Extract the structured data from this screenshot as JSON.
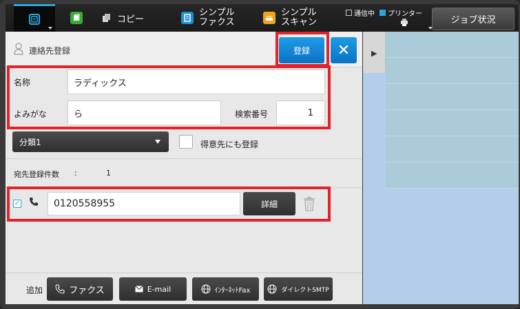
{
  "topbar": {
    "copy_label": "コピー",
    "simple_fax_label_1": "シンプル",
    "simple_fax_label_2": "ファクス",
    "simple_scan_label_1": "シンプル",
    "simple_scan_label_2": "スキャン",
    "status_sending": "通信中",
    "status_printer": "プリンター",
    "job_status_button": "ジョブ状況",
    "accent_color": "#2aa6e0"
  },
  "header": {
    "title": "連絡先登録",
    "register_button": "登録",
    "close_button": "✕"
  },
  "form": {
    "name_label": "名称",
    "name_value": "ラディックス",
    "reading_label": "よみがな",
    "reading_value": "ら",
    "search_number_label": "検索番号",
    "search_number_value": "1",
    "category_value": "分類1",
    "favorite_label": "得意先にも登録"
  },
  "destinations": {
    "count_label": "宛先登録件数",
    "count_separator": ":",
    "count_value": "1",
    "entries": [
      {
        "checked": true,
        "type_icon": "phone-icon",
        "value": "0120558955",
        "detail_button": "詳細",
        "delete_icon": "trash-icon"
      }
    ]
  },
  "footer": {
    "add_label": "追加",
    "buttons": [
      {
        "label": "ファクス",
        "icon": "fax-icon"
      },
      {
        "label": "E-mail",
        "icon": "mail-icon"
      },
      {
        "label": "ｲﾝﾀｰﾈｯﾄFax",
        "icon": "internet-fax-icon"
      },
      {
        "label": "ダイレクトSMTP",
        "icon": "direct-smtp-icon"
      }
    ]
  },
  "highlight_color": "#e2232a"
}
